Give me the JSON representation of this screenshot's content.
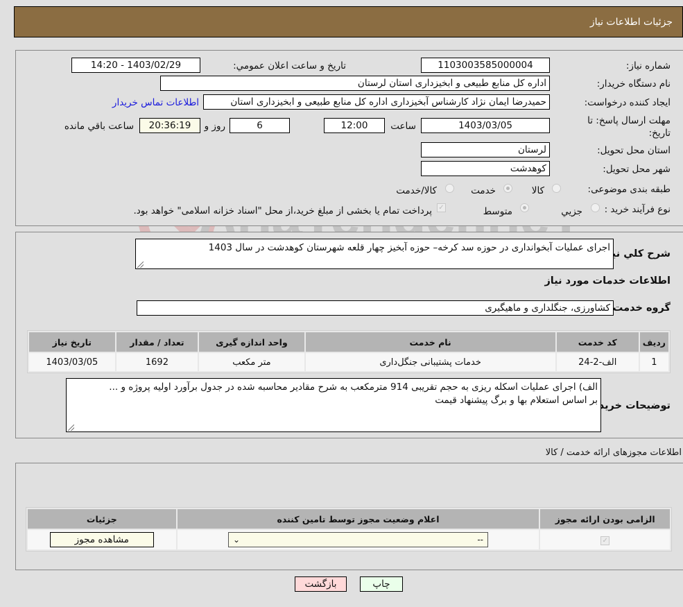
{
  "header": {
    "title": "جزئیات اطلاعات نیاز"
  },
  "details": {
    "need_number_label": "شماره نیاز:",
    "need_number": "1103003585000004",
    "announce_label": "تاریخ و ساعت اعلان عمومي:",
    "announce_value": "1403/02/29 - 14:20",
    "buyer_org_label": "نام دستگاه خريدار:",
    "buyer_org": "اداره کل منابع طبیعی و ابخیزداری استان لرستان",
    "requester_label": "ايجاد كننده درخواست:",
    "requester": "حمیدرضا ایمان نژاد کارشناس آبخیزداری اداره کل منابع طبیعی و ابخیزداری استان",
    "contact_link": "اطلاعات تماس خريدار",
    "deadline_label": "مهلت ارسال پاسخ: تا تاریخ:",
    "deadline_date": "1403/03/05",
    "time_label": "ساعت",
    "deadline_time": "12:00",
    "days_value": "6",
    "days_label": "روز و",
    "remaining_time": "20:36:19",
    "remaining_label": "ساعت باقي مانده",
    "province_label": "استان محل تحویل:",
    "province": "لرستان",
    "city_label": "شهر محل تحویل:",
    "city": "كوهدشت",
    "category_label": "طبقه بندی موضوعی:",
    "category_options": [
      {
        "label": "كالا",
        "selected": false
      },
      {
        "label": "خدمت",
        "selected": true
      },
      {
        "label": "كالا/خدمت",
        "selected": false
      }
    ],
    "process_label": "نوع فرآيند خريد :",
    "process_options": [
      {
        "label": "جزيي",
        "selected": false
      },
      {
        "label": "متوسط",
        "selected": true
      }
    ],
    "treasury_note": "پرداخت تمام يا بخشی از مبلغ خريد،از محل \"اسناد خزانه اسلامی\" خواهد بود."
  },
  "summary": {
    "general_desc_label": "شرح كلي نياز:",
    "general_desc": "اجرای عملیات آبخوانداری در حوزه سد کرخه– حوزه آبخیز چهار قلعه شهرستان کوهدشت  در سال 1403",
    "services_title": "اطلاعات خدمات مورد نیاز",
    "service_group_label": "گروه خدمت:",
    "service_group": "کشاورزی، جنگلداری و ماهیگیری",
    "table": {
      "headers": [
        "ردیف",
        "كد خدمت",
        "نام خدمت",
        "واحد اندازه گیری",
        "تعداد / مقدار",
        "تاریخ نیاز"
      ],
      "rows": [
        [
          "1",
          "الف-2-24",
          "خدمات پشتیبانی جنگل‌داری",
          "متر مکعب",
          "1692",
          "1403/03/05"
        ]
      ]
    },
    "buyer_notes_label": "توضيحات خريدار:",
    "buyer_notes_line1": "الف) اجرای عملیات اسکله ریزی به حجم تقریبی 914 مترمکعب به شرح مقادیر محاسبه شده در جدول برآورد اولیه پروژه و ...",
    "buyer_notes_line2": "بر اساس استعلام بها و برگ پیشنهاد قیمت"
  },
  "permits": {
    "section_title": "اطلاعات مجوزهای ارائه خدمت / کالا",
    "headers": [
      "الزامی بودن ارائه مجوز",
      "اعلام وضعیت مجوز توسط تامین کننده",
      "جزئیات"
    ],
    "row": {
      "required_checked": true,
      "status_value": "--",
      "details_button": "مشاهده مجوز"
    }
  },
  "buttons": {
    "print": "چاپ",
    "back": "بازگشت"
  },
  "watermark": "AriaTender.neT",
  "colors": {
    "header": "#8b6d42",
    "link": "#1a1adc",
    "back_button": "#ffd9d9",
    "print_button": "#eaffea"
  }
}
